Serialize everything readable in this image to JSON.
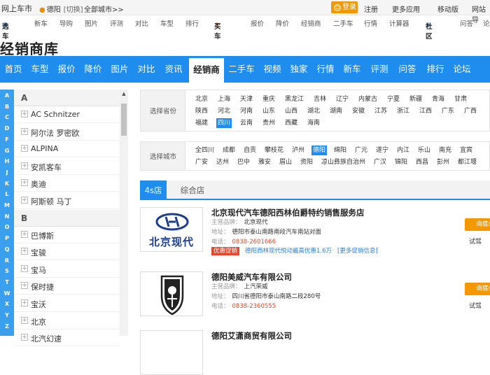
{
  "topbar": {
    "brand": "网上车市",
    "location": "德阳",
    "switch": "[切换]",
    "all_cities": "全部城市>>",
    "login": "登录",
    "register": "注册",
    "more_apps": "更多应用",
    "mobile": "移动版",
    "more": "网站导"
  },
  "subnav": {
    "select_car": "选车",
    "new_car": "新车",
    "guide": "导购",
    "pictures": "图片",
    "review": "评测",
    "compare": "对比",
    "models": "车型",
    "ranking": "排行",
    "buy_car": "买车",
    "quote": "报价",
    "price_cut": "降价",
    "dealers": "经销商",
    "used_car": "二手车",
    "market": "行情",
    "calculator": "计算器",
    "community": "社区",
    "qa": "问答",
    "forum": "论"
  },
  "page_title": "经销商库",
  "main_nav": [
    "首页",
    "车型",
    "报价",
    "降价",
    "图片",
    "对比",
    "资讯",
    "经销商",
    "二手车",
    "视频",
    "独家",
    "行情",
    "新车",
    "评测",
    "问答",
    "排行",
    "论坛"
  ],
  "main_nav_active": "经销商",
  "alphabet": [
    "A",
    "B",
    "C",
    "D",
    "F",
    "G",
    "H",
    "J",
    "K",
    "L",
    "M",
    "N",
    "O",
    "P",
    "Q",
    "R",
    "S",
    "T",
    "W",
    "X",
    "Y",
    "Z"
  ],
  "brand_groups": [
    {
      "letter": "A",
      "items": [
        "AC Schnitzer",
        "阿尔法 罗密欧",
        "ALPINA",
        "安凯客车",
        "奥迪",
        "阿斯顿 马丁"
      ]
    },
    {
      "letter": "B",
      "items": [
        "巴博斯",
        "宝骏",
        "宝马",
        "保时捷",
        "宝沃",
        "北京",
        "北汽幻速"
      ]
    }
  ],
  "province_filter": {
    "label": "选择省份",
    "options": [
      "北京",
      "上海",
      "天津",
      "重庆",
      "黑龙江",
      "吉林",
      "辽宁",
      "内蒙古",
      "宁夏",
      "新疆",
      "青海",
      "甘肃",
      "陕西",
      "河北",
      "河南",
      "山东",
      "山西",
      "湖北",
      "湖南",
      "安徽",
      "江苏",
      "浙江",
      "江西",
      "广东",
      "广西",
      "福建",
      "四川",
      "云南",
      "贵州",
      "西藏",
      "海南"
    ],
    "selected": "四川"
  },
  "city_filter": {
    "label": "选择城市",
    "options": [
      "全四川",
      "成都",
      "自贡",
      "攀枝花",
      "泸州",
      "德阳",
      "绵阳",
      "广元",
      "遂宁",
      "内江",
      "乐山",
      "南充",
      "宜宾",
      "广安",
      "达州",
      "巴中",
      "雅安",
      "眉山",
      "资阳",
      "凉山彝族自治州",
      "广汉",
      "锦阳",
      "西昌",
      "彭州",
      "都江堰"
    ],
    "selected": "德阳"
  },
  "tabs": [
    "4s店",
    "综合店"
  ],
  "tabs_active": "4s店",
  "labels": {
    "brand": "主营品牌：",
    "address": "地址：",
    "phone": "电话：",
    "inquiry": "询底价",
    "test_drive": "试驾",
    "promo_badge": "优惠促销"
  },
  "dealers": [
    {
      "name": "北京现代汽车德阳西林伯爵特约销售服务店",
      "brand": "北京现代",
      "address": "德阳市泰山南路南段汽车南站对面",
      "phone": "0838-2601666",
      "promo": "德阳西林现代悦动最高优惠1.6万",
      "promo_more": "[更多促销信息]",
      "logo_text": "北京现代",
      "logo_color": "#1c3e8e"
    },
    {
      "name": "德阳美威汽车有限公司",
      "brand": "上汽荣威",
      "address": "四川省德阳市泰山南路二段280号",
      "phone": "0838-2360555"
    },
    {
      "name": "德阳艾潇商贸有限公司"
    }
  ],
  "colors": {
    "accent_blue": "#1e8ded",
    "orange": "#f39800",
    "red": "#e04a2c"
  }
}
